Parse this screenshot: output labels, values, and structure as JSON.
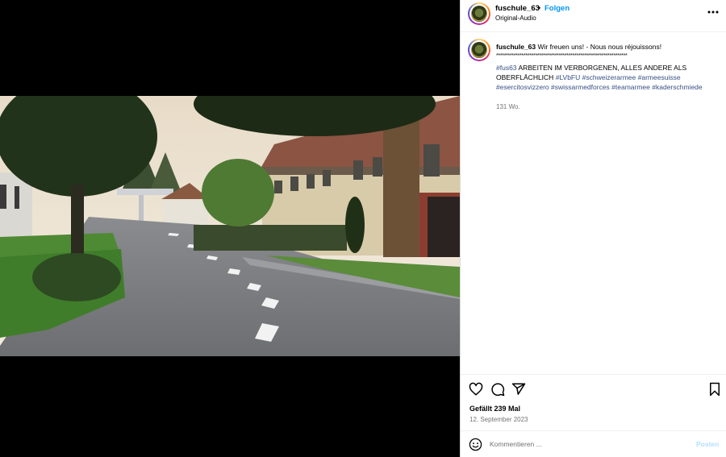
{
  "post": {
    "username": "fuschule_63",
    "separator": "•",
    "follow_label": "Folgen",
    "audio_label": "Original-Audio"
  },
  "caption": {
    "username": "fuschule_63",
    "line1": "Wir freuen uns! - Nous nous réjouissons!",
    "stars": "*******************************************************************",
    "hashtag_fus63": "#fus63",
    "text": "ARBEITEN IM VERBORGENEN, ALLES ANDERE ALS OBERFLÄCHLICH",
    "hashtags": [
      "#LVbFU",
      "#schweizerarmee",
      "#armeesuisse",
      "#esercitosvizzero",
      "#swissarmedforces",
      "#teamarmee",
      "#kaderschmiede"
    ],
    "time_ago": "131 Wo."
  },
  "stats": {
    "likes": "Gefällt 239 Mal",
    "date": "12. September 2023"
  },
  "comment": {
    "placeholder": "Kommentieren ...",
    "post_label": "Posten"
  },
  "icons": {
    "more": "more-options-icon",
    "like": "heart-icon",
    "comment": "comment-icon",
    "share": "send-icon",
    "save": "bookmark-icon",
    "emoji": "emoji-icon",
    "mute": "muted-speaker-icon"
  },
  "colors": {
    "link": "#0095f6",
    "hashtag": "#385185",
    "muted_text": "#737373"
  }
}
